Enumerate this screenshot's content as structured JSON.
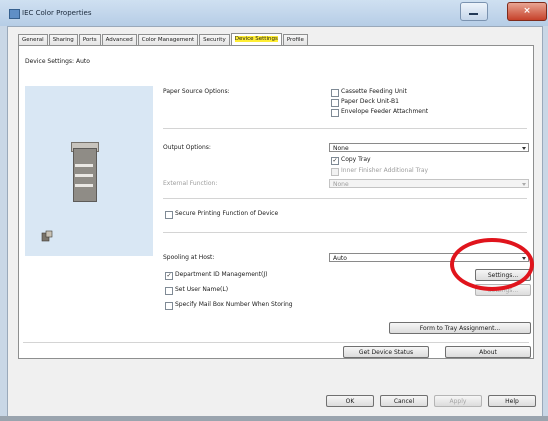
{
  "window": {
    "title": "IEC Color Properties",
    "close_label": "×"
  },
  "tabs": [
    {
      "label": "General"
    },
    {
      "label": "Sharing"
    },
    {
      "label": "Ports"
    },
    {
      "label": "Advanced"
    },
    {
      "label": "Color Management"
    },
    {
      "label": "Security"
    },
    {
      "label": "Device Settings",
      "active": true
    },
    {
      "label": "Profile"
    }
  ],
  "device_settings_label": "Device Settings: Auto",
  "paper_source": {
    "label": "Paper Source Options:",
    "options": [
      {
        "label": "Cassette Feeding Unit",
        "checked": false
      },
      {
        "label": "Paper Deck Unit-B1",
        "checked": false
      },
      {
        "label": "Envelope Feeder Attachment",
        "checked": false
      }
    ]
  },
  "output": {
    "label": "Output Options:",
    "select_value": "None",
    "copy_tray": {
      "label": "Copy Tray",
      "checked": true
    },
    "inner_finisher": {
      "label": "Inner Finisher Additional Tray",
      "checked": false
    }
  },
  "external_function": {
    "label": "External Function:",
    "select_value": "None"
  },
  "secure_printing": {
    "label": "Secure Printing Function of Device",
    "checked": false
  },
  "spooling": {
    "label": "Spooling at Host:",
    "select_value": "Auto"
  },
  "dept_id": {
    "label": "Department ID Management(J)",
    "checked": true
  },
  "set_user": {
    "label": "Set User Name(L)",
    "checked": false
  },
  "mailbox": {
    "label": "Specify Mail Box Number When Storing",
    "checked": false
  },
  "buttons": {
    "settings": "Settings...",
    "settings2": "Settings...",
    "form_to_tray": "Form to Tray Assignment...",
    "get_status": "Get Device Status",
    "about": "About",
    "ok": "OK",
    "cancel": "Cancel",
    "apply": "Apply",
    "help": "Help"
  },
  "colors": {
    "highlight_ring": "#e0141c",
    "active_tab_marker": "#ffee33",
    "preview_background": "#d9e7f4"
  }
}
